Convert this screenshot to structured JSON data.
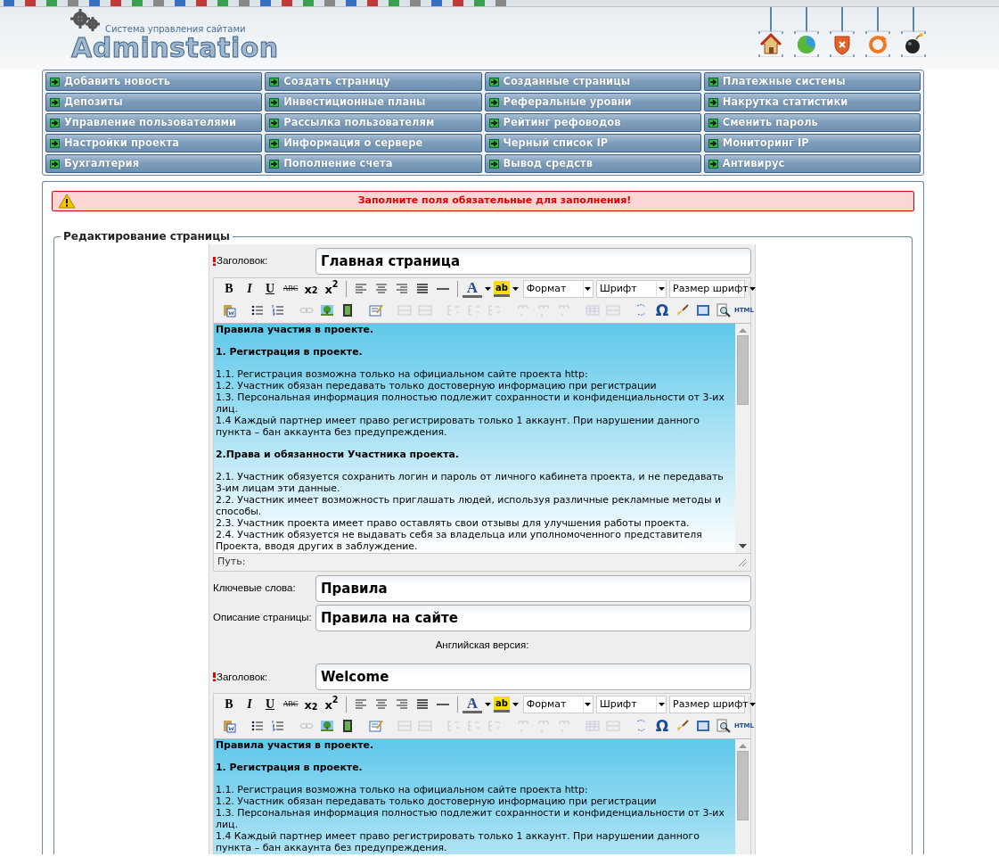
{
  "header": {
    "logo": {
      "tagline": "Система управления сайтами",
      "name": "Adminstation"
    },
    "quick_icons": [
      {
        "kind": "home"
      },
      {
        "kind": "chart"
      },
      {
        "kind": "shield"
      },
      {
        "kind": "refresh"
      },
      {
        "kind": "bomb"
      }
    ]
  },
  "menu": [
    "Добавить новость",
    "Создать страницу",
    "Созданные страницы",
    "Платежные системы",
    "Депозиты",
    "Инвестиционные планы",
    "Реферальные уровни",
    "Накрутка статистики",
    "Управление пользователями",
    "Рассылка пользователям",
    "Рейтинг рефоводов",
    "Сменить пароль",
    "Настройки проекта",
    "Информация о сервере",
    "Черный список IP",
    "Мониторинг IP",
    "Бухгалтерия",
    "Пополнение счета",
    "Вывод средств",
    "Антивирус"
  ],
  "alert": {
    "text": "Заполните поля обязательные для заполнения!"
  },
  "fieldset": {
    "legend": "Редактирование страницы"
  },
  "form": [
    {
      "kind": "field",
      "required": true,
      "label": "Заголовок:",
      "value": "Главная страница"
    },
    {
      "kind": "editor",
      "path_label": "Путь:",
      "toolbar": [
        [
          {
            "kind": "bold",
            "label": "B",
            "disabled": false
          },
          {
            "kind": "italic",
            "label": "I",
            "disabled": false
          },
          {
            "kind": "underline",
            "label": "U",
            "disabled": false
          },
          {
            "kind": "strike",
            "label": "ABC",
            "disabled": false
          },
          {
            "kind": "sub",
            "label": "x$_{2}$",
            "disabled": false
          },
          {
            "kind": "sup",
            "label": "x$^{2}$",
            "disabled": false
          },
          {
            "kind": "sep"
          },
          {
            "kind": "alignleft",
            "disabled": false
          },
          {
            "kind": "aligncenter",
            "disabled": false
          },
          {
            "kind": "alignright",
            "disabled": false
          },
          {
            "kind": "justify",
            "disabled": false
          },
          {
            "kind": "rule",
            "disabled": false
          },
          {
            "kind": "sep"
          },
          {
            "kind": "color",
            "label": "A",
            "disabled": false
          },
          {
            "kind": "highlight",
            "label": "ab",
            "disabled": false
          },
          {
            "kind": "select",
            "label": "Формат"
          },
          {
            "kind": "select",
            "label": "Шрифт"
          },
          {
            "kind": "select",
            "label": "Размер шрифт"
          }
        ],
        [
          {
            "kind": "paste",
            "disabled": false
          },
          {
            "kind": "sep"
          },
          {
            "kind": "bullets",
            "disabled": false
          },
          {
            "kind": "numbering",
            "disabled": false
          },
          {
            "kind": "sep"
          },
          {
            "kind": "link",
            "disabled": true
          },
          {
            "kind": "picture",
            "disabled": false
          },
          {
            "kind": "film",
            "disabled": false
          },
          {
            "kind": "sep"
          },
          {
            "kind": "form",
            "disabled": false
          },
          {
            "kind": "sep"
          },
          {
            "kind": "cells",
            "disabled": true
          },
          {
            "kind": "cells",
            "disabled": true
          },
          {
            "kind": "sep"
          },
          {
            "kind": "rows",
            "disabled": true
          },
          {
            "kind": "rows",
            "disabled": true
          },
          {
            "kind": "rows",
            "disabled": true
          },
          {
            "kind": "sep"
          },
          {
            "kind": "cols",
            "disabled": true
          },
          {
            "kind": "cols",
            "disabled": true
          },
          {
            "kind": "cols",
            "disabled": true
          },
          {
            "kind": "sep"
          },
          {
            "kind": "grid",
            "disabled": true
          },
          {
            "kind": "cells",
            "disabled": true
          },
          {
            "kind": "sep"
          },
          {
            "kind": "replace",
            "disabled": false
          },
          {
            "kind": "omega",
            "label": "Ω",
            "disabled": false
          },
          {
            "kind": "brush",
            "disabled": false
          },
          {
            "kind": "block",
            "disabled": false
          },
          {
            "kind": "preview",
            "disabled": false
          },
          {
            "kind": "html",
            "label": "HTML",
            "disabled": false
          }
        ]
      ],
      "content": [
        {
          "kind": "heading",
          "text": "Правила участия в проекте."
        },
        {
          "kind": "heading",
          "text": "1. Регистрация в проекте."
        },
        {
          "kind": "line",
          "text": "1.1. Регистрация возможна только на официальном сайте проекта http:"
        },
        {
          "kind": "line",
          "text": "1.2. Участник обязан передавать только достоверную информацию при регистрации"
        },
        {
          "kind": "line",
          "text": "1.3. Персональная информация полностью подлежит сохранности и конфиденциальности от 3-их лиц."
        },
        {
          "kind": "line",
          "text": "1.4 Каждый партнер имеет право регистрировать только 1 аккаунт. При нарушении данного пункта – бан аккаунта без предупреждения."
        },
        {
          "kind": "heading",
          "text": "2.Права и обязанности Участника проекта."
        },
        {
          "kind": "line",
          "text": "2.1. Участник обязуется сохранить логин и пароль от личного кабинета проекта, и не передавать 3-им лицам эти данные."
        },
        {
          "kind": "line",
          "text": "2.2. Участник имеет возможность приглашать людей, используя различные рекламные методы и способы."
        },
        {
          "kind": "line",
          "text": "2.3. Участник проекта имеет право оставлять свои отзывы для улучшения работы проекта."
        },
        {
          "kind": "line",
          "text": "2.4. Участник обязуется не выдавать себя за владельца или уполномоченного представителя Проекта, вводя других в заблуждение."
        }
      ]
    },
    {
      "kind": "field",
      "required": false,
      "label": "Ключевые слова:",
      "value": "Правила"
    },
    {
      "kind": "field",
      "required": false,
      "label": "Описание страницы:",
      "value": "Правила на сайте"
    },
    {
      "kind": "caption",
      "text": "Английская версия:"
    },
    {
      "kind": "field",
      "required": true,
      "label": "Заголовок:",
      "value": "Welcome"
    },
    {
      "kind": "editor",
      "toolbar": [
        [
          {
            "kind": "bold",
            "label": "B",
            "disabled": false
          },
          {
            "kind": "italic",
            "label": "I",
            "disabled": false
          },
          {
            "kind": "underline",
            "label": "U",
            "disabled": false
          },
          {
            "kind": "strike",
            "label": "ABC",
            "disabled": false
          },
          {
            "kind": "sub",
            "label": "x$_{2}$",
            "disabled": false
          },
          {
            "kind": "sup",
            "label": "x$^{2}$",
            "disabled": false
          },
          {
            "kind": "sep"
          },
          {
            "kind": "alignleft",
            "disabled": false
          },
          {
            "kind": "aligncenter",
            "disabled": false
          },
          {
            "kind": "alignright",
            "disabled": false
          },
          {
            "kind": "justify",
            "disabled": false
          },
          {
            "kind": "rule",
            "disabled": false
          },
          {
            "kind": "sep"
          },
          {
            "kind": "color",
            "label": "A",
            "disabled": false
          },
          {
            "kind": "highlight",
            "label": "ab",
            "disabled": false
          },
          {
            "kind": "select",
            "label": "Формат"
          },
          {
            "kind": "select",
            "label": "Шрифт"
          },
          {
            "kind": "select",
            "label": "Размер шрифт"
          }
        ],
        [
          {
            "kind": "paste",
            "disabled": false
          },
          {
            "kind": "sep"
          },
          {
            "kind": "bullets",
            "disabled": false
          },
          {
            "kind": "numbering",
            "disabled": false
          },
          {
            "kind": "sep"
          },
          {
            "kind": "link",
            "disabled": true
          },
          {
            "kind": "picture",
            "disabled": false
          },
          {
            "kind": "film",
            "disabled": false
          },
          {
            "kind": "sep"
          },
          {
            "kind": "form",
            "disabled": false
          },
          {
            "kind": "sep"
          },
          {
            "kind": "cells",
            "disabled": true
          },
          {
            "kind": "cells",
            "disabled": true
          },
          {
            "kind": "sep"
          },
          {
            "kind": "rows",
            "disabled": true
          },
          {
            "kind": "rows",
            "disabled": true
          },
          {
            "kind": "rows",
            "disabled": true
          },
          {
            "kind": "sep"
          },
          {
            "kind": "cols",
            "disabled": true
          },
          {
            "kind": "cols",
            "disabled": true
          },
          {
            "kind": "cols",
            "disabled": true
          },
          {
            "kind": "sep"
          },
          {
            "kind": "grid",
            "disabled": true
          },
          {
            "kind": "cells",
            "disabled": true
          },
          {
            "kind": "sep"
          },
          {
            "kind": "replace",
            "disabled": false
          },
          {
            "kind": "omega",
            "label": "Ω",
            "disabled": false
          },
          {
            "kind": "brush",
            "disabled": false
          },
          {
            "kind": "block",
            "disabled": false
          },
          {
            "kind": "preview",
            "disabled": false
          },
          {
            "kind": "html",
            "label": "HTML",
            "disabled": false
          }
        ]
      ],
      "content": [
        {
          "kind": "heading",
          "text": "Правила участия в проекте."
        },
        {
          "kind": "heading",
          "text": "1. Регистрация в проекте."
        },
        {
          "kind": "line",
          "text": "1.1. Регистрация возможна только на официальном сайте проекта http:"
        },
        {
          "kind": "line",
          "text": "1.2. Участник обязан передавать только достоверную информацию при регистрации"
        },
        {
          "kind": "line",
          "text": "1.3. Персональная информация полностью подлежит сохранности и конфиденциальности от 3-их лиц."
        },
        {
          "kind": "line",
          "text": "1.4 Каждый партнер имеет право регистрировать только 1 аккаунт. При нарушении данного пункта – бан аккаунта без предупреждения."
        }
      ]
    }
  ]
}
